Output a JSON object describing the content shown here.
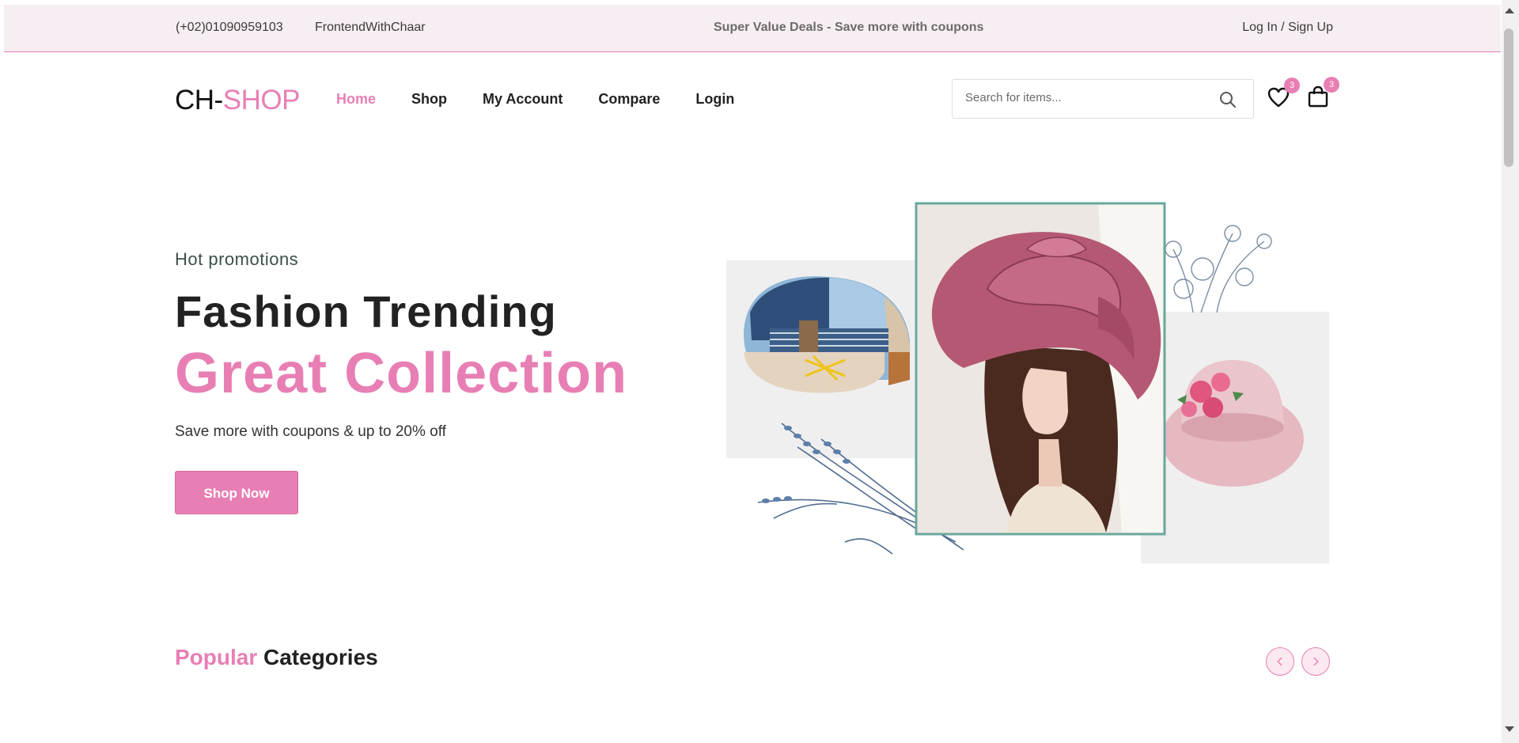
{
  "topbar": {
    "phone": "(+02)01090959103",
    "brand": "FrontendWithChaar",
    "deals": "Super Value Deals - Save more with coupons",
    "auth": "Log In / Sign Up"
  },
  "header": {
    "logo_prefix": "CH-",
    "logo_suffix": "SHOP",
    "nav": [
      "Home",
      "Shop",
      "My Account",
      "Compare",
      "Login"
    ],
    "active_nav": "Home",
    "search_placeholder": "Search for items...",
    "wishlist_count": "3",
    "cart_count": "3"
  },
  "hero": {
    "kicker": "Hot promotions",
    "title": "Fashion Trending",
    "title_highlight": "Great Collection",
    "subtitle": "Save more with coupons & up to 20% off",
    "cta": "Shop Now"
  },
  "categories": {
    "title_highlight": "Popular",
    "title_rest": "Categories",
    "prev_icon": "chevron-left-icon",
    "next_icon": "chevron-right-icon"
  },
  "colors": {
    "accent": "#e87fb4",
    "topbar_bg": "#f7eef3",
    "frame": "#6aa79c"
  }
}
